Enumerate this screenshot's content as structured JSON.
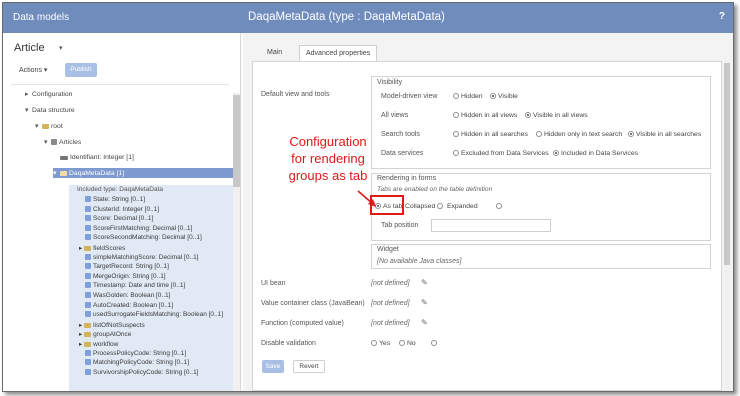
{
  "topbar": {
    "left_title": "Data models",
    "main_title": "DaqaMetaData (type : DaqaMetaData)",
    "help": "?"
  },
  "left": {
    "title": "Article",
    "title_caret": "▾",
    "actions": "Actions ▾",
    "publish": "Publish",
    "tree": [
      {
        "label": "Configuration",
        "caret": "▸"
      },
      {
        "label": "Data structure",
        "caret": "▾"
      },
      {
        "label": "root",
        "caret": "▾"
      },
      {
        "label": "Articles",
        "caret": "▾"
      },
      {
        "label": "Identifiant: Integer  [1]",
        "caret": ""
      },
      {
        "label": "DaqaMetaData [1]",
        "caret": "▾"
      }
    ],
    "included_title": "Included type: DaqaMetaData",
    "included_items": [
      {
        "label": "State: String  [0..1]",
        "type": "attr"
      },
      {
        "label": "ClusterId: Integer  [0..1]",
        "type": "attr"
      },
      {
        "label": "Score: Decimal  [0..1]",
        "type": "attr"
      },
      {
        "label": "ScoreFirstMatching: Decimal  [0..1]",
        "type": "attr"
      },
      {
        "label": "ScoreSecondMatching: Decimal  [0..1]",
        "type": "attr"
      },
      {
        "label": "fieldScores",
        "type": "folder"
      },
      {
        "label": "simpleMatchingScore: Decimal  [0..1]",
        "type": "attr"
      },
      {
        "label": "TargetRecord: String  [0..1]",
        "type": "attr"
      },
      {
        "label": "MergeOrigin: String  [0..1]",
        "type": "attr"
      },
      {
        "label": "Timestamp: Date and time  [0..1]",
        "type": "attr"
      },
      {
        "label": "WasGolden: Boolean  [0..1]",
        "type": "attr"
      },
      {
        "label": "AutoCreated: Boolean  [0..1]",
        "type": "attr"
      },
      {
        "label": "usedSurrogateFieldsMatching: Boolean  [0..1]",
        "type": "attr"
      },
      {
        "label": "listOfNotSuspects",
        "type": "folder"
      },
      {
        "label": "groupAtOnce",
        "type": "folder"
      },
      {
        "label": "workflow",
        "type": "folder"
      },
      {
        "label": "ProcessPolicyCode: String  [0..1]",
        "type": "attr"
      },
      {
        "label": "MatchingPolicyCode: String  [0..1]",
        "type": "attr"
      },
      {
        "label": "SurvivorshipPolicyCode: String  [0..1]",
        "type": "attr"
      }
    ]
  },
  "right": {
    "tabs": [
      "Main",
      "Advanced properties"
    ],
    "default_view_label": "Default view and tools",
    "visibility": {
      "title": "Visibility",
      "rows": [
        {
          "label": "Model-driven view",
          "options": [
            "Hidden",
            "Visible"
          ],
          "selected": 1
        },
        {
          "label": "All views",
          "options": [
            "Hidden in all views",
            "Visible in all views"
          ],
          "selected": 1
        },
        {
          "label": "Search tools",
          "options": [
            "Hidden in all searches",
            "Hidden only in text search",
            "Visible in all searches"
          ],
          "selected": 2
        },
        {
          "label": "Data services",
          "options": [
            "Excluded from Data Services",
            "Included in Data Services"
          ],
          "selected": 1
        }
      ]
    },
    "rendering": {
      "title": "Rendering in forms",
      "note": "Tabs are enabled on the table definition",
      "options": [
        "As tab",
        "Collapsed",
        "Expanded"
      ],
      "selected": 0,
      "tab_position_label": "Tab position",
      "tab_position_value": ""
    },
    "widget": {
      "title": "Widget",
      "value": "[No available Java classes]"
    },
    "ui_bean": {
      "label": "UI bean",
      "value": "[not defined]"
    },
    "value_container": {
      "label": "Value container class (JavaBean)",
      "value": "[not defined]"
    },
    "function": {
      "label": "Function (computed value)",
      "value": "[not defined]"
    },
    "disable_validation": {
      "label": "Disable validation",
      "options": [
        "Yes",
        "No"
      ]
    },
    "save": "Save",
    "revert": "Revert"
  },
  "annotation": {
    "lines": [
      "Configuration",
      "for rendering",
      "groups as tab"
    ],
    "color": "#e01919"
  },
  "colors": {
    "topbar": "#6f8cbc",
    "selected_row": "#7f9ad0",
    "included_bg": "#e1e9f5",
    "publish": "#a9c0e6"
  }
}
